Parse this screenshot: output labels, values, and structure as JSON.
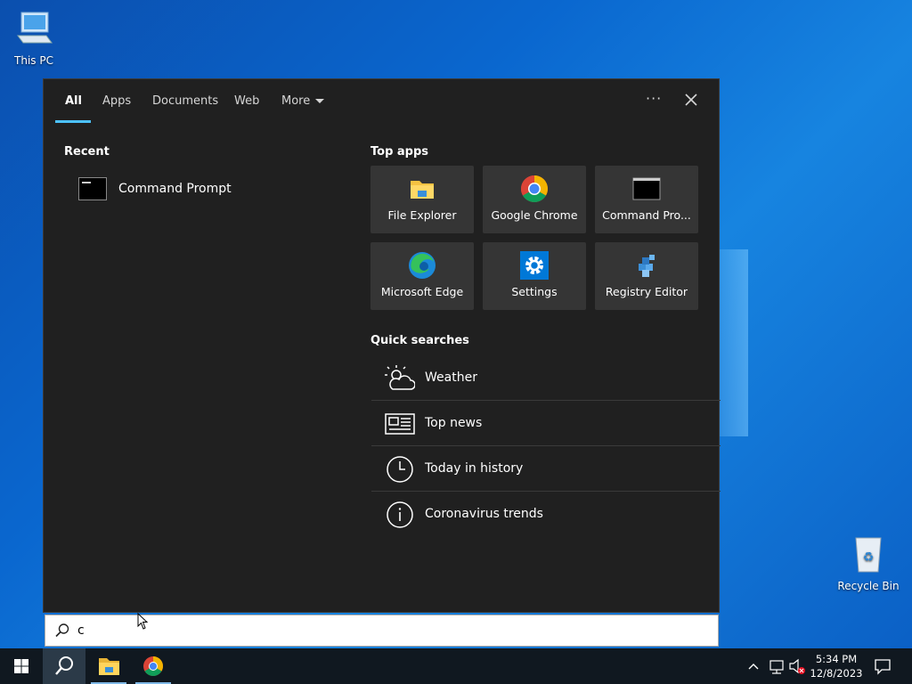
{
  "desktop": {
    "icons": [
      {
        "label": "This PC"
      },
      {
        "label": "Recycle Bin"
      }
    ]
  },
  "search_panel": {
    "tabs": [
      {
        "label": "All",
        "active": true
      },
      {
        "label": "Apps"
      },
      {
        "label": "Documents"
      },
      {
        "label": "Web"
      },
      {
        "label": "More"
      }
    ],
    "ellipsis_label": "···",
    "recent": {
      "title": "Recent",
      "items": [
        {
          "label": "Command Prompt",
          "icon": "command-prompt-icon"
        }
      ]
    },
    "top_apps": {
      "title": "Top apps",
      "tiles": [
        {
          "label": "File Explorer",
          "icon": "file-explorer-icon"
        },
        {
          "label": "Google Chrome",
          "icon": "chrome-icon"
        },
        {
          "label": "Command Pro...",
          "icon": "command-prompt-icon"
        },
        {
          "label": "Microsoft Edge",
          "icon": "edge-icon"
        },
        {
          "label": "Settings",
          "icon": "settings-gear-icon"
        },
        {
          "label": "Registry Editor",
          "icon": "registry-editor-icon"
        }
      ]
    },
    "quick_searches": {
      "title": "Quick searches",
      "items": [
        {
          "label": "Weather",
          "icon": "weather-icon"
        },
        {
          "label": "Top news",
          "icon": "news-icon"
        },
        {
          "label": "Today in history",
          "icon": "clock-icon"
        },
        {
          "label": "Coronavirus trends",
          "icon": "info-icon"
        }
      ]
    }
  },
  "search_box": {
    "value": "c"
  },
  "taskbar": {
    "clock": {
      "time": "5:34 PM",
      "date": "12/8/2023"
    }
  },
  "colors": {
    "accent": "#4cc2ff",
    "panel_bg": "#202020",
    "tile_bg": "#353535",
    "taskbar_bg": "#101820"
  }
}
